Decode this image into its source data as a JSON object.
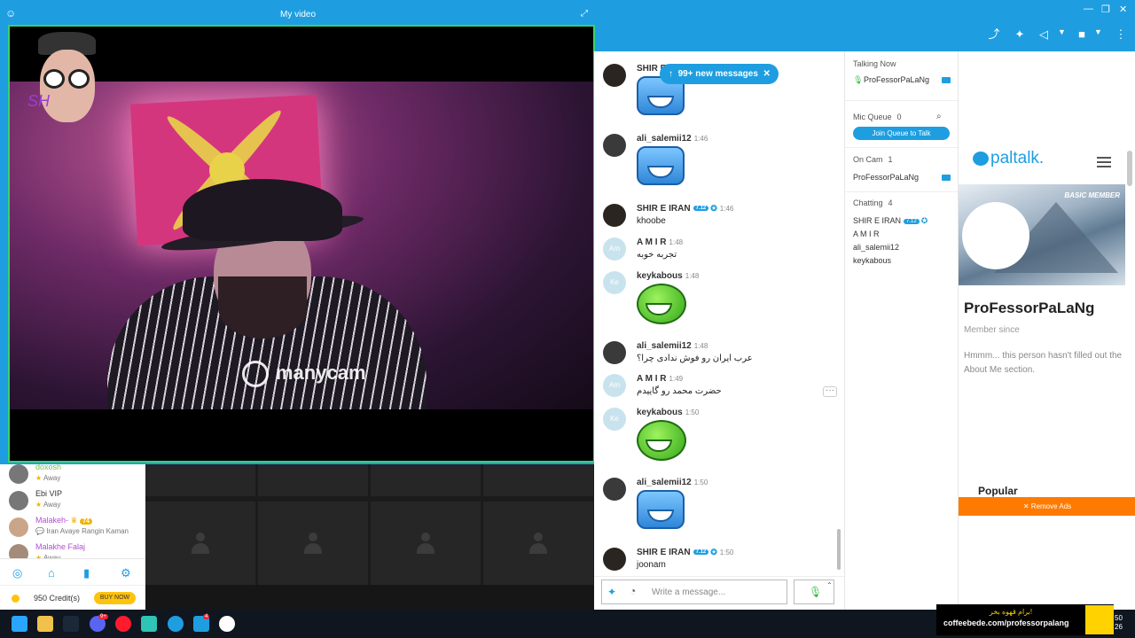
{
  "video": {
    "title": "My video",
    "watermark": "manycam"
  },
  "new_messages": {
    "label": "99+ new messages"
  },
  "chat": {
    "messages": [
      {
        "name": "SHIR E IRAN",
        "time": "",
        "type": "emoji",
        "emoji": "laughing-blue"
      },
      {
        "name": "ali_salemii12",
        "time": "1:46",
        "type": "emoji",
        "emoji": "laughing-blue"
      },
      {
        "name": "SHIR E IRAN",
        "time": "1:46",
        "badge": "7.12",
        "text": "khoobe"
      },
      {
        "name": "A M I R",
        "time": "1:48",
        "initials": "Am",
        "text": "تجربه خوبه"
      },
      {
        "name": "keykabous",
        "time": "1:48",
        "initials": "Ke",
        "type": "emoji",
        "emoji": "laughing-green"
      },
      {
        "name": "ali_salemii12",
        "time": "1:48",
        "text": "عرب ایران رو فوش ندادی چرا؟"
      },
      {
        "name": "A M I R",
        "time": "1:49",
        "initials": "Am",
        "text": "حضرت محمد رو گاییدم"
      },
      {
        "name": "keykabous",
        "time": "1:50",
        "initials": "Ke",
        "type": "emoji",
        "emoji": "laughing-green"
      },
      {
        "name": "ali_salemii12",
        "time": "1:50",
        "type": "emoji",
        "emoji": "laughing-blue"
      },
      {
        "name": "SHIR E IRAN",
        "time": "1:50",
        "badge": "7.12",
        "text": "joonam"
      }
    ],
    "composer_placeholder": "Write a message..."
  },
  "room": {
    "talking_now_label": "Talking Now",
    "talking_now_user": "ProFessorPaLaNg",
    "mic_queue_label": "Mic Queue",
    "mic_queue_count": "0",
    "join_queue_label": "Join Queue to Talk",
    "on_cam_label": "On Cam",
    "on_cam_count": "1",
    "on_cam_user": "ProFessorPaLaNg",
    "chatting_label": "Chatting",
    "chatting_count": "4",
    "chatting_users": [
      "SHIR E IRAN",
      "A M I R",
      "ali_salemii12",
      "keykabous"
    ],
    "chatting_badge": "7.12"
  },
  "profile": {
    "logo": "paltalk.",
    "badge": "BASIC MEMBER",
    "name": "ProFessorPaLaNg",
    "member_since": "Member since",
    "about": "Hmmm... this person hasn't filled out the About Me section.",
    "popular": "Popular",
    "remove_ads": "✕ Remove Ads"
  },
  "left_users": [
    {
      "name": "doxosh",
      "status": "Away",
      "color": "#7bbf3f"
    },
    {
      "name": "Ebi VIP",
      "status": "Away",
      "color": "#333333"
    },
    {
      "name": "Malakeh-",
      "badge": "74",
      "status": "Iran Avaye Rangin Kaman",
      "color": "#b04fd1"
    },
    {
      "name": "Malakhe Falaj",
      "status": "Away",
      "color": "#b04fd1"
    }
  ],
  "credits": {
    "label": "950 Credit(s)",
    "buy": "BUY NOW"
  },
  "coffee_ad": {
    "line1": "برام قهوه بخر!",
    "line2": "coffeebede.com/professorpalang"
  },
  "clock": {
    "line1": "50",
    "line2": "26"
  },
  "taskbar": {
    "discord_badge": "9+",
    "paltalk_badge": "4"
  },
  "colors": {
    "accent": "#1e9ee0",
    "cam_border": "#3bd16f",
    "remove_ads": "#ff7a00"
  }
}
